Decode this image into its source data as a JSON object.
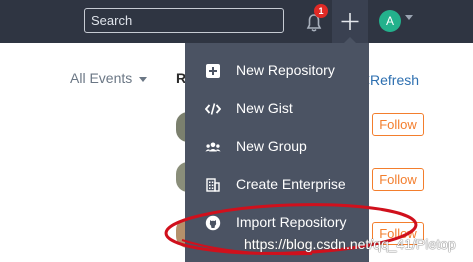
{
  "header": {
    "search_placeholder": "Search",
    "notifications_count": "1",
    "avatar_initial": "A"
  },
  "feed": {
    "filter_label": "All Events",
    "title_partial": "R",
    "refresh_label": "Refresh",
    "follow_labels": [
      "Follow",
      "Follow",
      "Follow"
    ]
  },
  "create_menu": {
    "items": [
      {
        "label": "New Repository",
        "icon": "plus-square-icon"
      },
      {
        "label": "New Gist",
        "icon": "code-icon"
      },
      {
        "label": "New Group",
        "icon": "group-icon"
      },
      {
        "label": "Create Enterprise",
        "icon": "building-icon"
      },
      {
        "label": "Import Repository",
        "icon": "github-icon"
      }
    ]
  },
  "watermark": "https://blog.csdn.net/qq_41/Pietop",
  "colors": {
    "topbar": "#2f3542",
    "menu_bg": "#4b5363",
    "follow": "#f37e2d",
    "highlight": "#d0101c",
    "avatar": "#23b18c"
  }
}
